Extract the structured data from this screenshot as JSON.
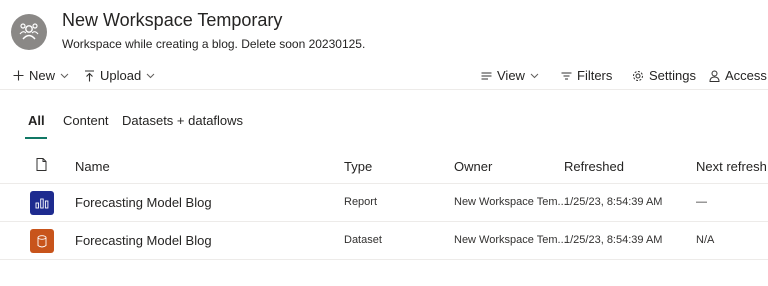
{
  "workspace": {
    "icon": "workspace-icon",
    "title": "New Workspace Temporary",
    "description": "Workspace while creating a blog. Delete soon 20230125."
  },
  "toolbar": {
    "new_label": "New",
    "upload_label": "Upload",
    "view_label": "View",
    "filters_label": "Filters",
    "settings_label": "Settings",
    "access_label": "Access"
  },
  "tabs": [
    {
      "label": "All",
      "selected": true
    },
    {
      "label": "Content",
      "selected": false
    },
    {
      "label": "Datasets + dataflows",
      "selected": false
    }
  ],
  "table": {
    "columns": [
      "Name",
      "Type",
      "Owner",
      "Refreshed",
      "Next refresh"
    ],
    "rows": [
      {
        "icon": "report-icon",
        "icon_color": "#1e2b8f",
        "name": "Forecasting Model Blog",
        "type": "Report",
        "owner": "New Workspace Tem...",
        "refreshed": "1/25/23, 8:54:39 AM",
        "next_refresh": "—"
      },
      {
        "icon": "dataset-icon",
        "icon_color": "#c8541b",
        "name": "Forecasting Model Blog",
        "type": "Dataset",
        "owner": "New Workspace Tem...",
        "refreshed": "1/25/23, 8:54:39 AM",
        "next_refresh": "N/A"
      }
    ]
  },
  "colors": {
    "accent": "#117865",
    "report": "#1e2b8f",
    "dataset": "#c8541b"
  }
}
